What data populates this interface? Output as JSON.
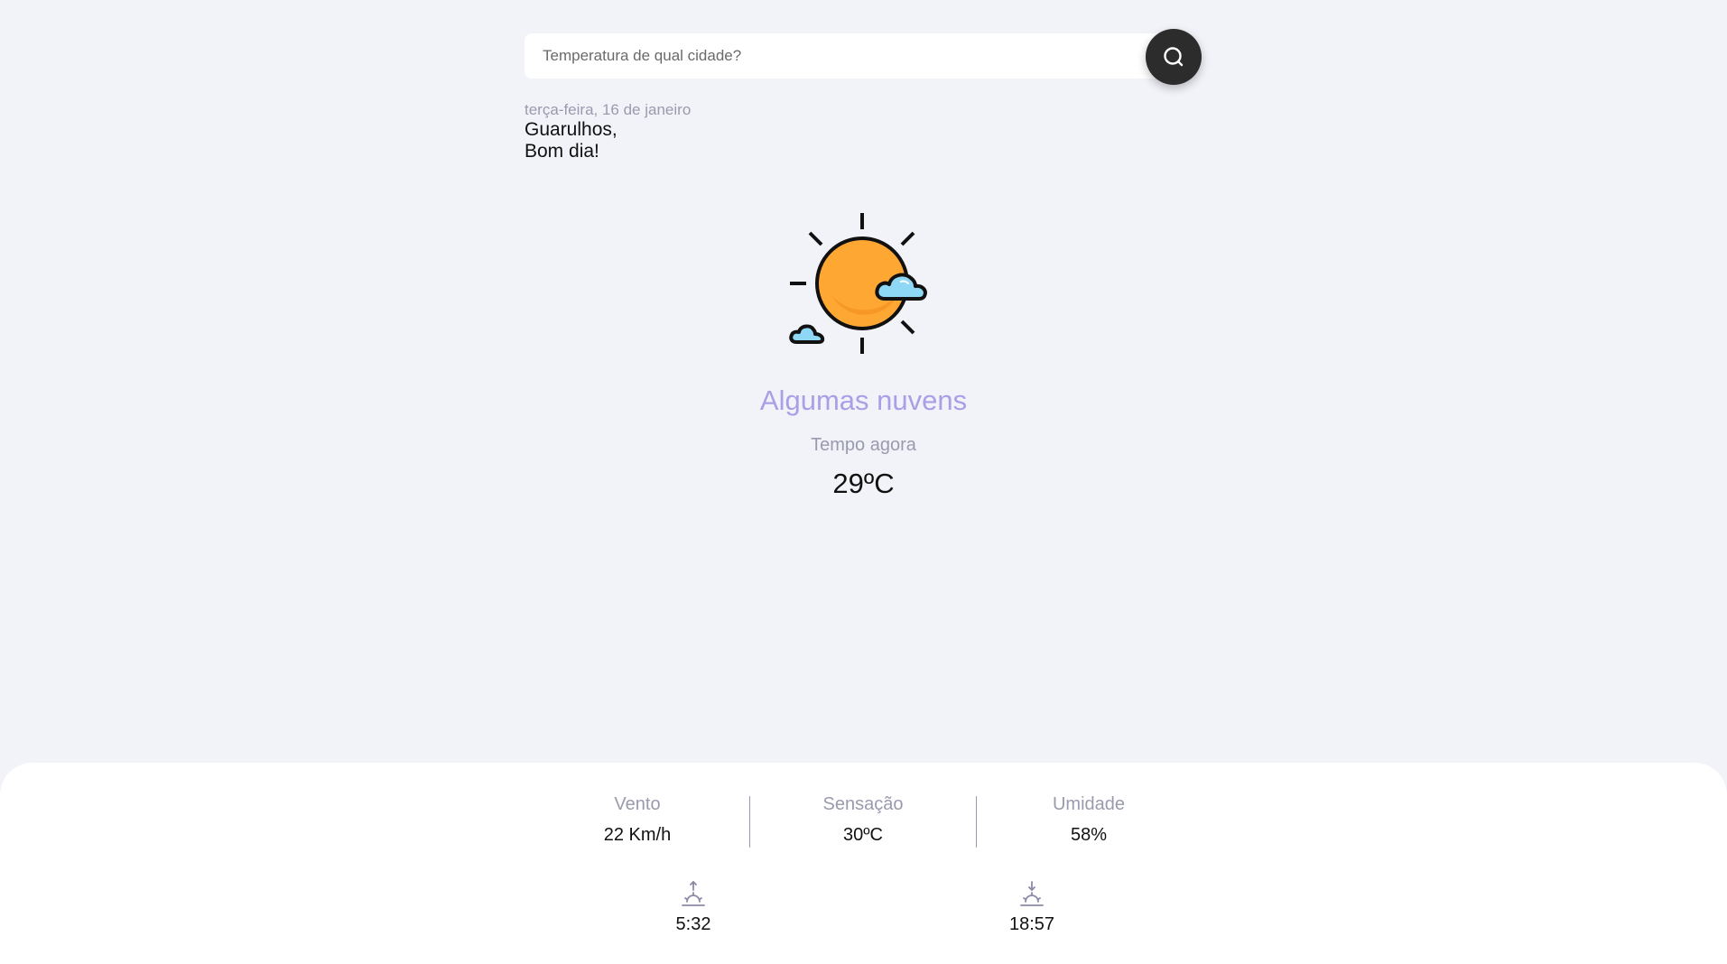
{
  "search": {
    "placeholder": "Temperatura de qual cidade?",
    "button_icon": "search-icon"
  },
  "location": {
    "date": "terça-feira, 16 de janeiro",
    "city": "Guarulhos,",
    "greeting": "Bom dia!"
  },
  "weather": {
    "icon": "sun-with-clouds-icon",
    "condition": "Algumas nuvens",
    "now_label": "Tempo agora",
    "temperature": "29ºC"
  },
  "stats": {
    "wind": {
      "label": "Vento",
      "value": "22 Km/h"
    },
    "feels_like": {
      "label": "Sensação",
      "value": "30ºC"
    },
    "humidity": {
      "label": "Umidade",
      "value": "58%"
    }
  },
  "sun": {
    "sunrise": {
      "icon": "sunrise-icon",
      "time": "5:32"
    },
    "sunset": {
      "icon": "sunset-icon",
      "time": "18:57"
    }
  },
  "colors": {
    "background": "#f2f3f9",
    "accent": "#a99fe6",
    "muted_text": "#9a9aae",
    "search_button": "#2c2c2c",
    "sun_orange": "#ffa733",
    "cloud_blue": "#8fd8f5"
  }
}
